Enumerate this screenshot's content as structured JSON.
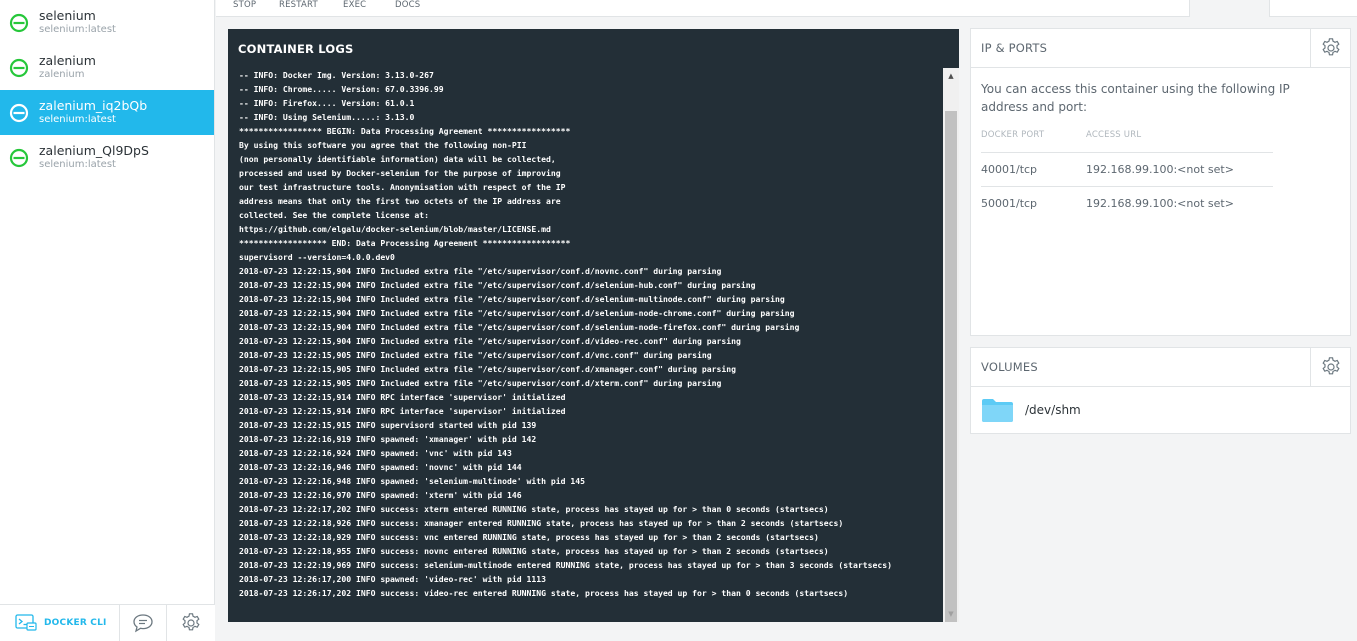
{
  "sidebar": {
    "containers": [
      {
        "name": "selenium",
        "image": "selenium:latest",
        "active": false
      },
      {
        "name": "zalenium",
        "image": "zalenium",
        "active": false
      },
      {
        "name": "zalenium_iq2bQb",
        "image": "selenium:latest",
        "active": true
      },
      {
        "name": "zalenium_Ql9DpS",
        "image": "selenium:latest",
        "active": false
      }
    ],
    "footer": {
      "cli_label": "DOCKER CLI"
    }
  },
  "toolbar": {
    "stop": "STOP",
    "restart": "RESTART",
    "exec": "EXEC",
    "docs": "DOCS"
  },
  "logs": {
    "title": "CONTAINER LOGS",
    "lines": [
      "-- INFO: Docker Img. Version: 3.13.0-267",
      "-- INFO: Chrome..... Version: 67.0.3396.99",
      "-- INFO: Firefox.... Version: 61.0.1",
      "-- INFO: Using Selenium.....: 3.13.0",
      "***************** BEGIN: Data Processing Agreement *****************",
      "By using this software you agree that the following non-PII",
      "(non personally identifiable information) data will be collected,",
      "processed and used by Docker-selenium for the purpose of improving",
      "our test infrastructure tools. Anonymisation with respect of the IP",
      "address means that only the first two octets of the IP address are",
      "collected. See the complete license at:",
      "https://github.com/elgalu/docker-selenium/blob/master/LICENSE.md",
      "****************** END: Data Processing Agreement ******************",
      "supervisord --version=4.0.0.dev0",
      "2018-07-23 12:22:15,904 INFO Included extra file \"/etc/supervisor/conf.d/novnc.conf\" during parsing",
      "2018-07-23 12:22:15,904 INFO Included extra file \"/etc/supervisor/conf.d/selenium-hub.conf\" during parsing",
      "2018-07-23 12:22:15,904 INFO Included extra file \"/etc/supervisor/conf.d/selenium-multinode.conf\" during parsing",
      "2018-07-23 12:22:15,904 INFO Included extra file \"/etc/supervisor/conf.d/selenium-node-chrome.conf\" during parsing",
      "2018-07-23 12:22:15,904 INFO Included extra file \"/etc/supervisor/conf.d/selenium-node-firefox.conf\" during parsing",
      "2018-07-23 12:22:15,904 INFO Included extra file \"/etc/supervisor/conf.d/video-rec.conf\" during parsing",
      "2018-07-23 12:22:15,905 INFO Included extra file \"/etc/supervisor/conf.d/vnc.conf\" during parsing",
      "2018-07-23 12:22:15,905 INFO Included extra file \"/etc/supervisor/conf.d/xmanager.conf\" during parsing",
      "2018-07-23 12:22:15,905 INFO Included extra file \"/etc/supervisor/conf.d/xterm.conf\" during parsing",
      "2018-07-23 12:22:15,914 INFO RPC interface 'supervisor' initialized",
      "2018-07-23 12:22:15,914 INFO RPC interface 'supervisor' initialized",
      "2018-07-23 12:22:15,915 INFO supervisord started with pid 139",
      "2018-07-23 12:22:16,919 INFO spawned: 'xmanager' with pid 142",
      "2018-07-23 12:22:16,924 INFO spawned: 'vnc' with pid 143",
      "2018-07-23 12:22:16,946 INFO spawned: 'novnc' with pid 144",
      "2018-07-23 12:22:16,948 INFO spawned: 'selenium-multinode' with pid 145",
      "2018-07-23 12:22:16,970 INFO spawned: 'xterm' with pid 146",
      "2018-07-23 12:22:17,202 INFO success: xterm entered RUNNING state, process has stayed up for > than 0 seconds (startsecs)",
      "2018-07-23 12:22:18,926 INFO success: xmanager entered RUNNING state, process has stayed up for > than 2 seconds (startsecs)",
      "2018-07-23 12:22:18,929 INFO success: vnc entered RUNNING state, process has stayed up for > than 2 seconds (startsecs)",
      "2018-07-23 12:22:18,955 INFO success: novnc entered RUNNING state, process has stayed up for > than 2 seconds (startsecs)",
      "2018-07-23 12:22:19,969 INFO success: selenium-multinode entered RUNNING state, process has stayed up for > than 3 seconds (startsecs)",
      "2018-07-23 12:26:17,200 INFO spawned: 'video-rec' with pid 1113",
      "2018-07-23 12:26:17,202 INFO success: video-rec entered RUNNING state, process has stayed up for > than 0 seconds (startsecs)"
    ]
  },
  "ip_ports": {
    "title": "IP & PORTS",
    "description": "You can access this container using the following IP address and port:",
    "col_port": "DOCKER PORT",
    "col_url": "ACCESS URL",
    "rows": [
      {
        "port": "40001/tcp",
        "url": "192.168.99.100:<not set>"
      },
      {
        "port": "50001/tcp",
        "url": "192.168.99.100:<not set>"
      }
    ]
  },
  "volumes": {
    "title": "VOLUMES",
    "items": [
      {
        "path": "/dev/shm"
      }
    ]
  },
  "colors": {
    "accent": "#22b8eb",
    "status_green": "#26c73a",
    "log_bg": "#232f37"
  }
}
